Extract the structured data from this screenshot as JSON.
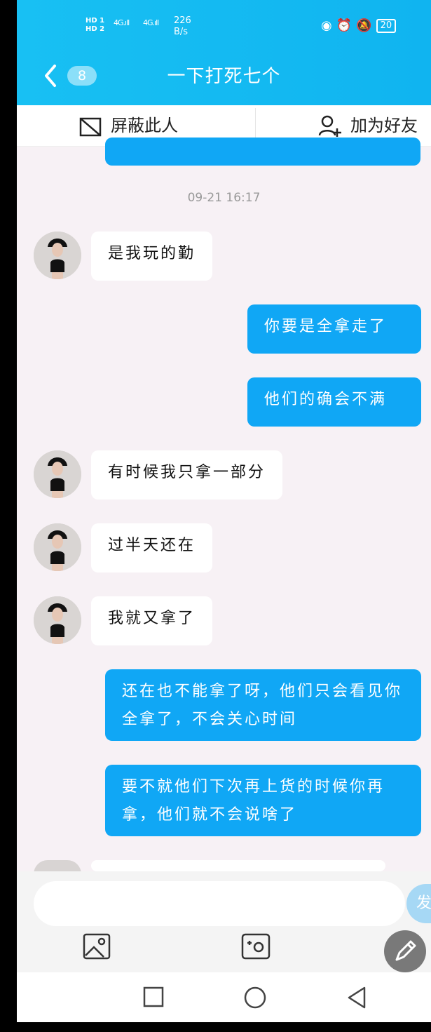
{
  "status_bar": {
    "network_label_1": "HD 1",
    "network_label_2": "HD 2",
    "signal_1": "4G",
    "signal_2": "4G",
    "speed_value": "226",
    "speed_unit": "B/s",
    "battery": "20"
  },
  "header": {
    "back_badge": "8",
    "title": "一下打死七个"
  },
  "actions": {
    "block_label": "屏蔽此人",
    "add_friend_label": "加为好友"
  },
  "chat": {
    "timestamp": "09-21 16:17",
    "messages": [
      {
        "side": "in",
        "text": "是我玩的勤"
      },
      {
        "side": "out",
        "text": "你要是全拿走了"
      },
      {
        "side": "out",
        "text": "他们的确会不满"
      },
      {
        "side": "in",
        "text": "有时候我只拿一部分"
      },
      {
        "side": "in",
        "text": "过半天还在"
      },
      {
        "side": "in",
        "text": "我就又拿了"
      },
      {
        "side": "out",
        "text": "还在也不能拿了呀，他们只会看见你全拿了，不会关心时间"
      },
      {
        "side": "out",
        "text": "要不就他们下次再上货的时候你再拿，他们就不会说啥了"
      }
    ]
  },
  "input": {
    "send_label": "发"
  },
  "colors": {
    "header_blue": "#18c0f3",
    "outgoing_bubble": "#10a7f5",
    "chat_background": "#f7f1f5"
  }
}
